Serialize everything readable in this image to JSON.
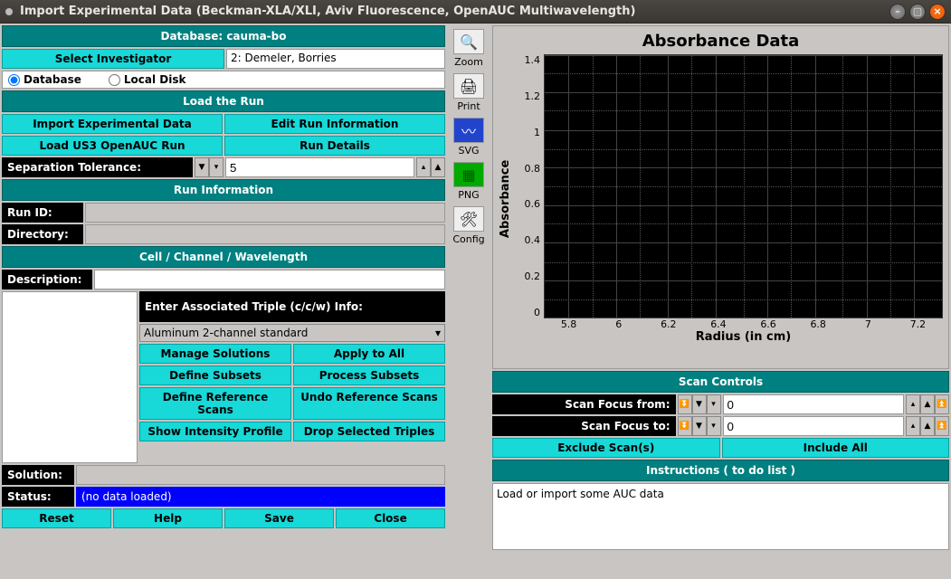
{
  "window": {
    "title": "Import Experimental Data (Beckman-XLA/XLI, Aviv Fluorescence, OpenAUC Multiwavelength)"
  },
  "left": {
    "db_header": "Database: cauma-bo",
    "select_investigator": "Select Investigator",
    "investigator_value": "2: Demeler, Borries",
    "radio_database": "Database",
    "radio_localdisk": "Local Disk",
    "load_run_header": "Load the Run",
    "import_exp": "Import Experimental Data",
    "edit_run": "Edit Run Information",
    "load_us3": "Load US3 OpenAUC Run",
    "run_details": "Run Details",
    "sep_tol": "Separation Tolerance:",
    "sep_tol_value": "5",
    "run_info_header": "Run Information",
    "run_id": "Run ID:",
    "directory": "Directory:",
    "ccw_header": "Cell / Channel / Wavelength",
    "description": "Description:",
    "triple_header": "Enter Associated Triple (c/c/w) Info:",
    "triple_select": "Aluminum 2-channel standard",
    "manage_solutions": "Manage Solutions",
    "apply_all": "Apply to All",
    "define_subsets": "Define Subsets",
    "process_subsets": "Process Subsets",
    "define_ref": "Define Reference Scans",
    "undo_ref": "Undo Reference Scans",
    "show_intensity": "Show Intensity Profile",
    "drop_triples": "Drop Selected Triples",
    "solution": "Solution:",
    "status": "Status:",
    "status_value": "(no data loaded)",
    "reset": "Reset",
    "help": "Help",
    "save": "Save",
    "close": "Close"
  },
  "tools": {
    "zoom": "Zoom",
    "print": "Print",
    "svg": "SVG",
    "png": "PNG",
    "config": "Config"
  },
  "right": {
    "scan_controls": "Scan Controls",
    "scan_from": "Scan Focus from:",
    "scan_from_val": "0",
    "scan_to": "Scan Focus to:",
    "scan_to_val": "0",
    "exclude": "Exclude Scan(s)",
    "include": "Include All",
    "instructions_header": "Instructions ( to do list )",
    "instructions_text": "Load or import some AUC data"
  },
  "chart_data": {
    "type": "line",
    "title": "Absorbance Data",
    "xlabel": "Radius (in cm)",
    "ylabel": "Absorbance",
    "xlim": [
      5.7,
      7.3
    ],
    "ylim": [
      0,
      1.5
    ],
    "xticks": [
      5.8,
      6,
      6.2,
      6.4,
      6.6,
      6.8,
      7,
      7.2
    ],
    "yticks": [
      0,
      0.2,
      0.4,
      0.6,
      0.8,
      1,
      1.2,
      1.4
    ],
    "series": []
  }
}
